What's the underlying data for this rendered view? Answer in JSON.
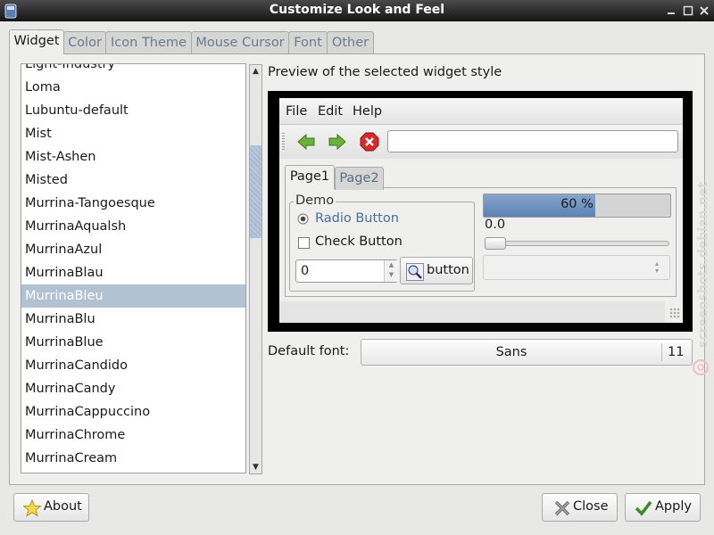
{
  "window": {
    "title": "Customize Look and Feel"
  },
  "tabs": [
    {
      "label": "Widget",
      "active": true
    },
    {
      "label": "Color"
    },
    {
      "label": "Icon Theme"
    },
    {
      "label": "Mouse Cursor"
    },
    {
      "label": "Font"
    },
    {
      "label": "Other"
    }
  ],
  "theme_list": {
    "items": [
      "Light-Industry",
      "Loma",
      "Lubuntu-default",
      "Mist",
      "Mist-Ashen",
      "Misted",
      "Murrina-Tangoesque",
      "MurrinaAqualsh",
      "MurrinaAzul",
      "MurrinaBlau",
      "MurrinaBleu",
      "MurrinaBlu",
      "MurrinaBlue",
      "MurrinaCandido",
      "MurrinaCandy",
      "MurrinaCappuccino",
      "MurrinaChrome",
      "MurrinaCream"
    ],
    "selected": "MurrinaBleu"
  },
  "preview": {
    "heading": "Preview of the selected widget style",
    "menu": [
      "File",
      "Edit",
      "Help"
    ],
    "toolbar_entry_value": "",
    "tabs": [
      "Page1",
      "Page2"
    ],
    "frame_label": "Demo",
    "radio_label": "Radio Button",
    "check_label": "Check Button",
    "spin_value": "0",
    "button_label": "button",
    "progress_percent": 60,
    "progress_text": "60 %",
    "scale_value": "0.0",
    "combo_value": ""
  },
  "default_font": {
    "label": "Default font:",
    "name": "Sans",
    "size": "11"
  },
  "buttons": {
    "about": "About",
    "close": "Close",
    "apply": "Apply"
  },
  "watermark": "screenshots.debian.net"
}
